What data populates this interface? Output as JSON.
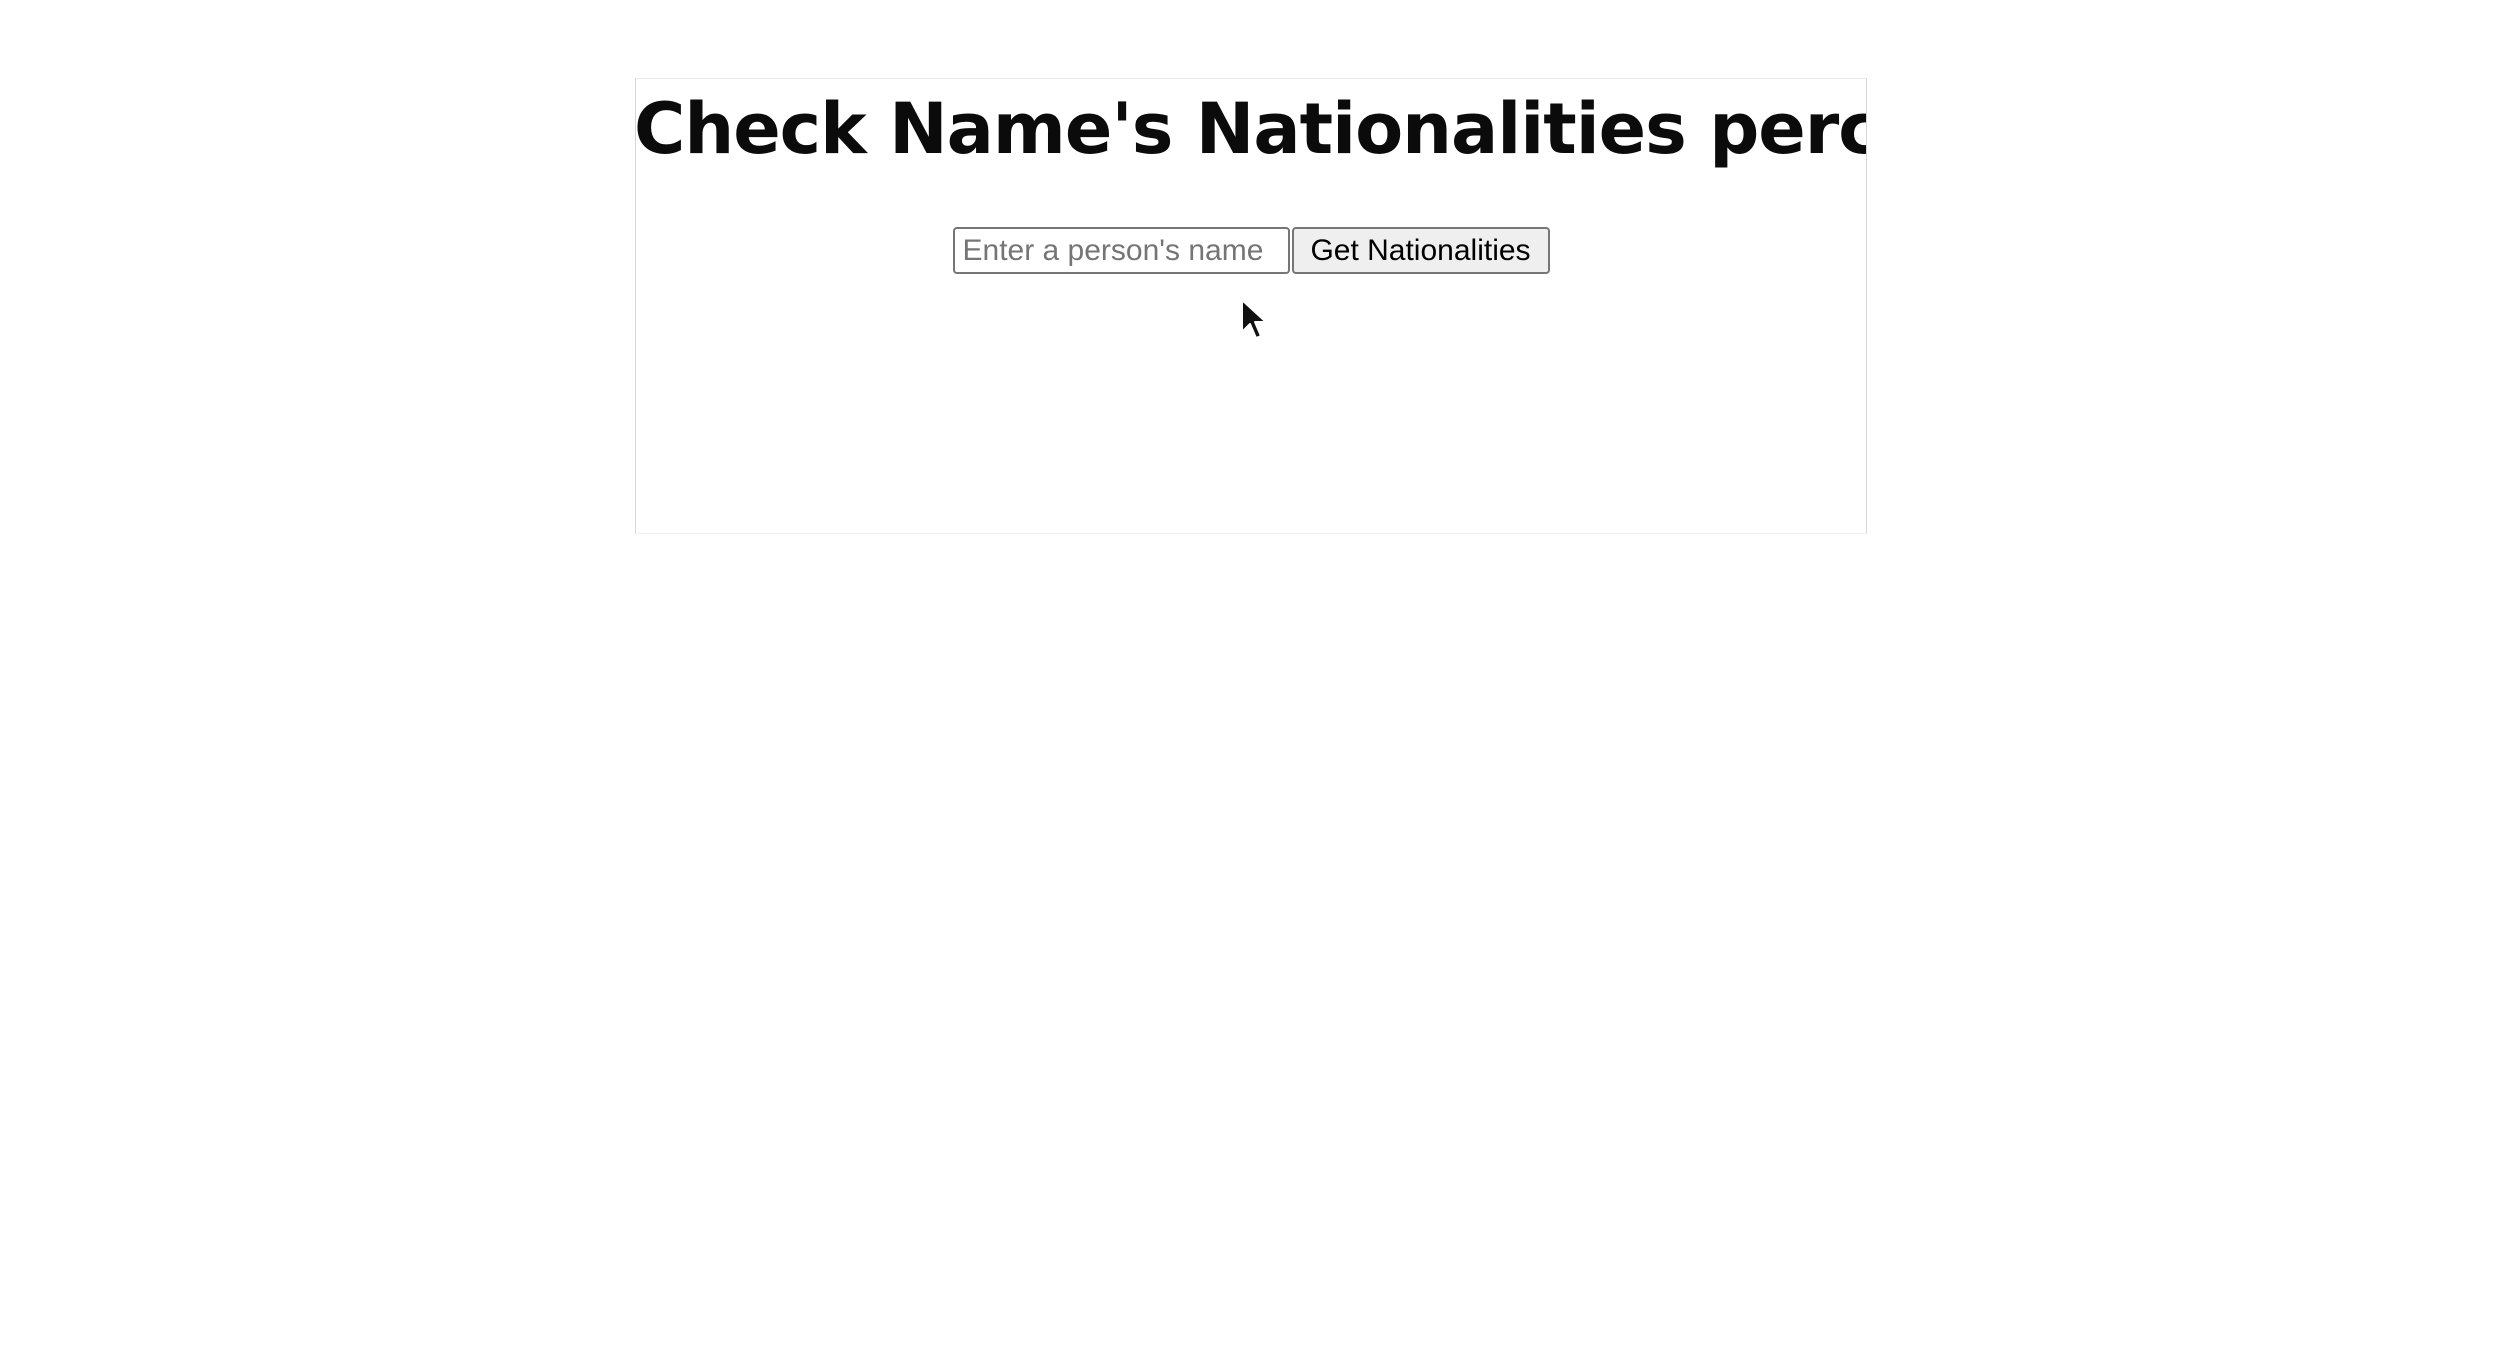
{
  "header": {
    "title": "Check Name's Nationalities percent"
  },
  "form": {
    "name_placeholder": "Enter a person's name",
    "name_value": "",
    "submit_label": "Get Nationalities"
  },
  "icons": {
    "cursor": "mouse-pointer-icon"
  }
}
